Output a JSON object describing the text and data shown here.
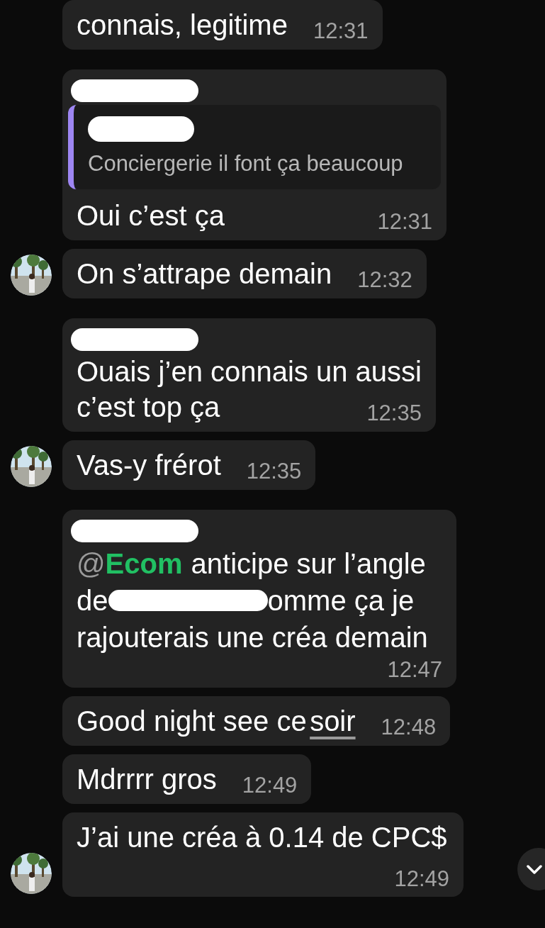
{
  "messages": [
    {
      "kind": "text",
      "avatar": false,
      "sender_redacted": false,
      "text": "connais, legitime",
      "time": "12:31"
    },
    {
      "kind": "reply",
      "avatar": false,
      "sender_redacted": true,
      "quote": {
        "author_redacted": true,
        "text": "Conciergerie il font ça beaucoup"
      },
      "text": "Oui c’est ça",
      "time": "12:31"
    },
    {
      "kind": "text",
      "avatar": true,
      "sender_redacted": false,
      "text": "On s’attrape demain",
      "time": "12:32"
    },
    {
      "kind": "lines",
      "avatar": false,
      "sender_redacted": true,
      "lines": [
        "Ouais j’en connais un aussi",
        "c’est top ça"
      ],
      "time": "12:35"
    },
    {
      "kind": "text",
      "avatar": true,
      "sender_redacted": false,
      "text": "Vas-y frérot",
      "time": "12:35"
    },
    {
      "kind": "mention",
      "avatar": false,
      "sender_redacted": true,
      "at": "@",
      "mention": "Ecom",
      "line1": "anticipe sur l’angle",
      "line2_start": "de",
      "line2_end": "omme ça je",
      "line3": "rajouterais une créa demain",
      "time": "12:47"
    },
    {
      "kind": "link",
      "avatar": false,
      "sender_redacted": false,
      "text": "Good night see ce",
      "link": "soir",
      "time": "12:48"
    },
    {
      "kind": "text",
      "avatar": false,
      "sender_redacted": false,
      "text": "Mdrrrr gros",
      "time": "12:49"
    },
    {
      "kind": "text",
      "avatar": true,
      "sender_redacted": false,
      "text": "J’ai une créa à 0.14 de CPC$",
      "time": "12:49"
    }
  ],
  "scroll_down_button": true
}
